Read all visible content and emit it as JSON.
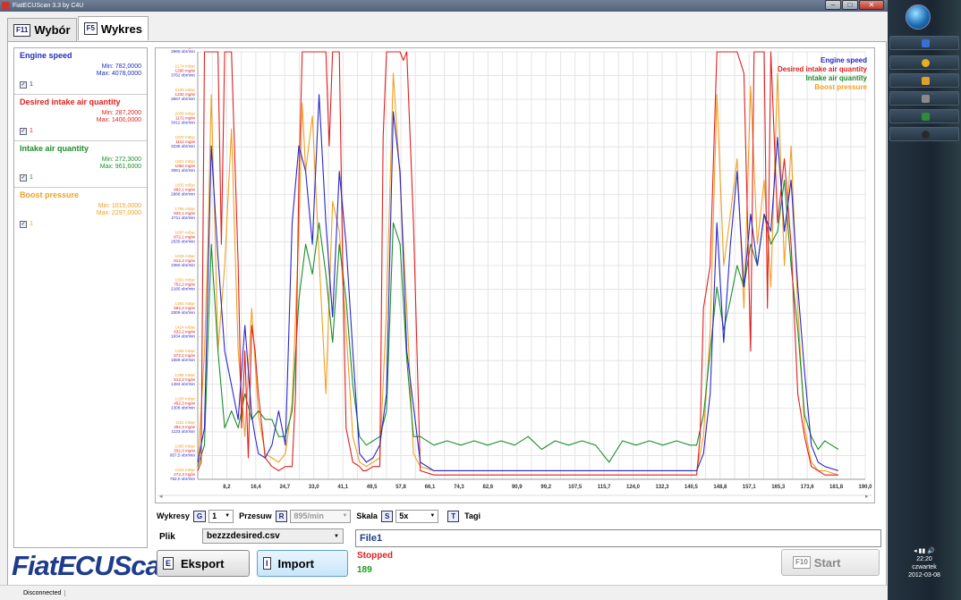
{
  "window": {
    "title": "FiatECUScan 3.3 by C4U",
    "buttons": [
      "–",
      "□",
      "✕"
    ]
  },
  "tabs": [
    {
      "key": "F11",
      "label": "Wybór"
    },
    {
      "key": "F5",
      "label": "Wykres"
    }
  ],
  "sensors": [
    {
      "name": "Engine speed",
      "min": "Min: 782,0000",
      "max": "Max: 4078,0000",
      "checkbox": "✓",
      "num": "1",
      "color": "#1f2fbf"
    },
    {
      "name": "Desired intake air quantity",
      "min": "Min: 287,2000",
      "max": "Max: 1400,0000",
      "checkbox": "✓",
      "num": "1",
      "color": "#e02020"
    },
    {
      "name": "Intake air quantity",
      "min": "Min: 272,3000",
      "max": "Max: 961,6000",
      "checkbox": "✓",
      "num": "1",
      "color": "#1a8f2a"
    },
    {
      "name": "Boost pressure",
      "min": "Min: 1015,0000",
      "max": "Max: 2297,0000",
      "checkbox": "✓",
      "num": "1",
      "color": "#f0a020"
    }
  ],
  "logo": "FiatECUScan",
  "chart_data": {
    "type": "line",
    "x_tick_labels": [
      "8,2",
      "16,4",
      "24,7",
      "33,0",
      "41,1",
      "49,5",
      "57,8",
      "66,1",
      "74,3",
      "82,6",
      "90,9",
      "99,2",
      "107,5",
      "115,7",
      "124,0",
      "132,3",
      "140,5",
      "148,8",
      "157,1",
      "165,3",
      "173,6",
      "181,8",
      "190,0"
    ],
    "xlim": [
      0,
      198
    ],
    "ylim": [
      0,
      1
    ],
    "y_tick_labels": [
      [
        "2243 mBar",
        "1362 mg/w",
        "3965 obr/min"
      ],
      [
        "2174 mBar",
        "1290 mg/w",
        "3762 obr/min"
      ],
      [
        "2105 mBar",
        "1232 mg/w",
        "3567 obr/min"
      ],
      [
        "2038 mBar",
        "1172 mg/w",
        "3412 obr/min"
      ],
      [
        "1970 mBar",
        "1112 mg/w",
        "3236 obr/min"
      ],
      [
        "1901 mBar",
        "1052 mg/w",
        "3061 obr/min"
      ],
      [
        "1833 mBar",
        "992,1 mg/w",
        "2886 obr/min"
      ],
      [
        "1765 mBar",
        "932,1 mg/w",
        "2711 obr/min"
      ],
      [
        "1697 mBar",
        "872,1 mg/w",
        "2535 obr/min"
      ],
      [
        "1628 mBar",
        "812,2 mg/w",
        "2360 obr/min"
      ],
      [
        "1561 mBar",
        "752,2 mg/w",
        "2185 obr/min"
      ],
      [
        "1492 mBar",
        "692,2 mg/w",
        "2009 obr/min"
      ],
      [
        "1424 mBar",
        "632,2 mg/w",
        "1834 obr/min"
      ],
      [
        "1356 mBar",
        "572,2 mg/w",
        "1659 obr/min"
      ],
      [
        "1288 mBar",
        "512,2 mg/w",
        "1483 obr/min"
      ],
      [
        "1220 mBar",
        "452,3 mg/w",
        "1308 obr/min"
      ],
      [
        "1151 mBar",
        "392,3 mg/w",
        "1133 obr/min"
      ],
      [
        "1083 mBar",
        "332,3 mg/w",
        "957,5 obr/min"
      ],
      [
        "1015 mBar",
        "272,3 mg/w",
        "782,0 obr/min"
      ]
    ],
    "series": [
      {
        "name": "Engine speed",
        "color": "#2828c8",
        "x": [
          0,
          2,
          4,
          6,
          8,
          10,
          12,
          14,
          16,
          17,
          18,
          20,
          22,
          24,
          26,
          28,
          30,
          32,
          34,
          36,
          38,
          40,
          42,
          44,
          46,
          48,
          50,
          52,
          54,
          56,
          58,
          60,
          62,
          66,
          70,
          80,
          100,
          120,
          140,
          148,
          150,
          152,
          154,
          156,
          158,
          160,
          162,
          164,
          166,
          168,
          170,
          172,
          174,
          176,
          178,
          180,
          182,
          184,
          186,
          190
        ],
        "y": [
          0.04,
          0.12,
          0.78,
          0.52,
          0.3,
          0.22,
          0.14,
          0.36,
          0.15,
          0.1,
          0.06,
          0.05,
          0.08,
          0.16,
          0.08,
          0.6,
          0.78,
          0.72,
          0.55,
          0.9,
          0.6,
          0.38,
          0.72,
          0.55,
          0.3,
          0.06,
          0.04,
          0.05,
          0.08,
          0.2,
          0.86,
          0.72,
          0.3,
          0.04,
          0.02,
          0.02,
          0.02,
          0.02,
          0.02,
          0.02,
          0.06,
          0.2,
          0.6,
          0.32,
          0.55,
          0.72,
          0.45,
          0.62,
          0.5,
          0.62,
          0.58,
          0.8,
          0.58,
          0.7,
          0.45,
          0.25,
          0.08,
          0.04,
          0.03,
          0.02
        ]
      },
      {
        "name": "Desired intake air quantity",
        "color": "#e02020",
        "x": [
          0,
          1,
          2,
          3,
          6,
          7,
          8,
          9,
          10,
          12,
          13,
          14,
          15,
          16,
          17,
          18,
          20,
          22,
          24,
          26,
          28,
          29,
          30,
          31,
          32,
          33,
          34,
          38,
          39,
          40,
          42,
          43,
          44,
          46,
          48,
          49,
          50,
          52,
          54,
          55,
          56,
          58,
          60,
          61,
          62,
          64,
          66,
          70,
          100,
          140,
          148,
          149,
          150,
          152,
          154,
          156,
          158,
          159,
          160,
          162,
          164,
          165,
          166,
          168,
          169,
          170,
          172,
          174,
          176,
          178,
          180,
          182,
          184,
          186,
          190
        ],
        "y": [
          0.02,
          0.04,
          1,
          1,
          1,
          0.55,
          1,
          1,
          1,
          0.5,
          0.12,
          0.3,
          0.05,
          0.36,
          0.3,
          0.2,
          0.05,
          0.03,
          0.02,
          0.03,
          0.03,
          0.2,
          0.7,
          1,
          1,
          1,
          1,
          1,
          0.78,
          1,
          1,
          0.5,
          0.12,
          0.04,
          0.03,
          0.02,
          0.02,
          0.03,
          0.03,
          0.8,
          1,
          1,
          1,
          0.98,
          1,
          0.6,
          0.02,
          0.01,
          0.01,
          0.01,
          0.01,
          0.1,
          0.4,
          0.5,
          1,
          1,
          1,
          1,
          1,
          0.95,
          0.3,
          1,
          1,
          1,
          0.4,
          1,
          0.6,
          0.75,
          0.55,
          0.2,
          0.1,
          0.03,
          0.02,
          0.01,
          0.01
        ]
      },
      {
        "name": "Intake air quantity",
        "color": "#1a8f2a",
        "x": [
          0,
          2,
          4,
          6,
          8,
          10,
          12,
          14,
          16,
          18,
          20,
          22,
          24,
          26,
          28,
          30,
          32,
          34,
          36,
          38,
          40,
          42,
          44,
          46,
          48,
          50,
          52,
          54,
          56,
          58,
          60,
          62,
          64,
          66,
          70,
          74,
          78,
          82,
          86,
          90,
          94,
          98,
          102,
          106,
          110,
          114,
          118,
          122,
          126,
          130,
          134,
          138,
          142,
          146,
          148,
          150,
          152,
          154,
          156,
          158,
          160,
          162,
          164,
          166,
          168,
          170,
          172,
          174,
          176,
          178,
          180,
          182,
          184,
          186,
          188,
          190
        ],
        "y": [
          0.03,
          0.08,
          0.55,
          0.3,
          0.12,
          0.16,
          0.12,
          0.2,
          0.14,
          0.16,
          0.14,
          0.14,
          0.1,
          0.1,
          0.16,
          0.42,
          0.55,
          0.48,
          0.6,
          0.48,
          0.32,
          0.55,
          0.42,
          0.22,
          0.1,
          0.08,
          0.09,
          0.1,
          0.16,
          0.6,
          0.55,
          0.28,
          0.1,
          0.1,
          0.08,
          0.09,
          0.08,
          0.09,
          0.08,
          0.09,
          0.08,
          0.1,
          0.07,
          0.09,
          0.08,
          0.09,
          0.08,
          0.04,
          0.09,
          0.08,
          0.09,
          0.08,
          0.09,
          0.08,
          0.08,
          0.15,
          0.3,
          0.45,
          0.35,
          0.42,
          0.5,
          0.45,
          0.55,
          0.5,
          0.62,
          0.55,
          0.58,
          0.7,
          0.5,
          0.35,
          0.15,
          0.1,
          0.07,
          0.09,
          0.08,
          0.07
        ]
      },
      {
        "name": "Boost pressure",
        "color": "#f0a020",
        "x": [
          0,
          2,
          3,
          4,
          5,
          6,
          8,
          10,
          12,
          14,
          16,
          18,
          20,
          22,
          24,
          26,
          28,
          30,
          31,
          32,
          34,
          36,
          38,
          40,
          42,
          44,
          46,
          48,
          50,
          52,
          54,
          56,
          58,
          60,
          62,
          64,
          66,
          70,
          80,
          100,
          120,
          140,
          148,
          150,
          152,
          154,
          156,
          158,
          160,
          162,
          164,
          166,
          168,
          170,
          172,
          174,
          176,
          178,
          180,
          182,
          184,
          186,
          190
        ],
        "y": [
          0.02,
          0.3,
          0.55,
          0.9,
          0.62,
          0.3,
          0.5,
          0.82,
          0.3,
          0.1,
          0.4,
          0.15,
          0.06,
          0.05,
          0.04,
          0.06,
          0.18,
          0.58,
          0.88,
          0.72,
          0.85,
          0.52,
          0.2,
          0.65,
          0.58,
          0.35,
          0.1,
          0.04,
          0.03,
          0.04,
          0.05,
          0.4,
          0.95,
          0.7,
          0.4,
          0.06,
          0.03,
          0.02,
          0.02,
          0.02,
          0.02,
          0.02,
          0.02,
          0.1,
          0.35,
          0.9,
          0.5,
          0.62,
          0.75,
          0.4,
          0.92,
          0.55,
          0.7,
          0.45,
          0.95,
          0.5,
          0.78,
          0.4,
          0.12,
          0.04,
          0.02,
          0.02,
          0.01
        ]
      }
    ]
  },
  "controls": {
    "wykresy_label": "Wykresy",
    "wykresy_key": "G",
    "wykresy_value": "1",
    "przesuw_label": "Przesuw",
    "przesuw_key": "R",
    "przesuw_value": "895/min",
    "skala_label": "Skala",
    "skala_key": "S",
    "skala_value": "5x",
    "tagi_key": "T",
    "tagi_label": "Tagi"
  },
  "file": {
    "label": "Plik",
    "selected": "bezzzdesired.csv",
    "eksport_key": "E",
    "eksport_label": "Eksport",
    "import_key": "I",
    "import_label": "Import",
    "name": "File1",
    "state": "Stopped",
    "count": "189",
    "start_key": "F10",
    "start_label": "Start"
  },
  "statusbar": {
    "text": "Disconnected"
  },
  "tray": {
    "time": "22:20",
    "day": "czwartek",
    "date": "2012-03-08"
  }
}
